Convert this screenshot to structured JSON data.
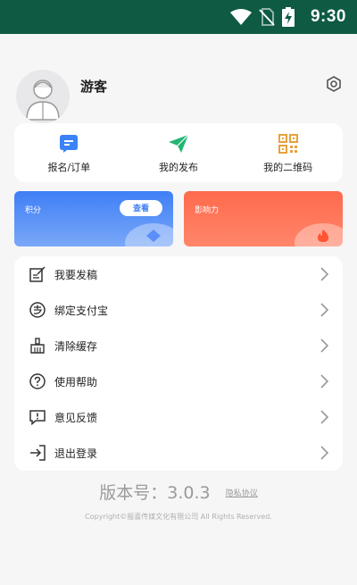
{
  "status_bar": {
    "time": "9:30",
    "icons": [
      "wifi-icon",
      "no-sim-icon",
      "battery-charging-icon"
    ],
    "background": "#0e5a43"
  },
  "profile": {
    "username": "游客",
    "avatar": "avatar-placeholder-icon",
    "settings_icon": "gear-icon"
  },
  "quick_actions": [
    {
      "label": "报名/订单",
      "icon": "order-icon",
      "color": "#3b82f6"
    },
    {
      "label": "我的发布",
      "icon": "paper-plane-icon",
      "color": "#22b573"
    },
    {
      "label": "我的二维码",
      "icon": "qr-code-icon",
      "color": "#e6a23c"
    }
  ],
  "cards": {
    "points": {
      "title": "积分",
      "button": "查看",
      "color": "#3f7ff6"
    },
    "influence": {
      "title": "影响力",
      "color": "#ff6a4c"
    }
  },
  "menu": [
    {
      "label": "我要发稿",
      "icon": "edit-note-icon"
    },
    {
      "label": "绑定支付宝",
      "icon": "alipay-icon"
    },
    {
      "label": "清除缓存",
      "icon": "broom-icon"
    },
    {
      "label": "使用帮助",
      "icon": "question-icon"
    },
    {
      "label": "意见反馈",
      "icon": "feedback-icon"
    },
    {
      "label": "退出登录",
      "icon": "logout-icon"
    }
  ],
  "footer": {
    "version": "版本号：3.0.3",
    "privacy": "隐私协议",
    "copyright": "Copyright©报喜传媒文化有限公司 All Rights Reserved."
  }
}
